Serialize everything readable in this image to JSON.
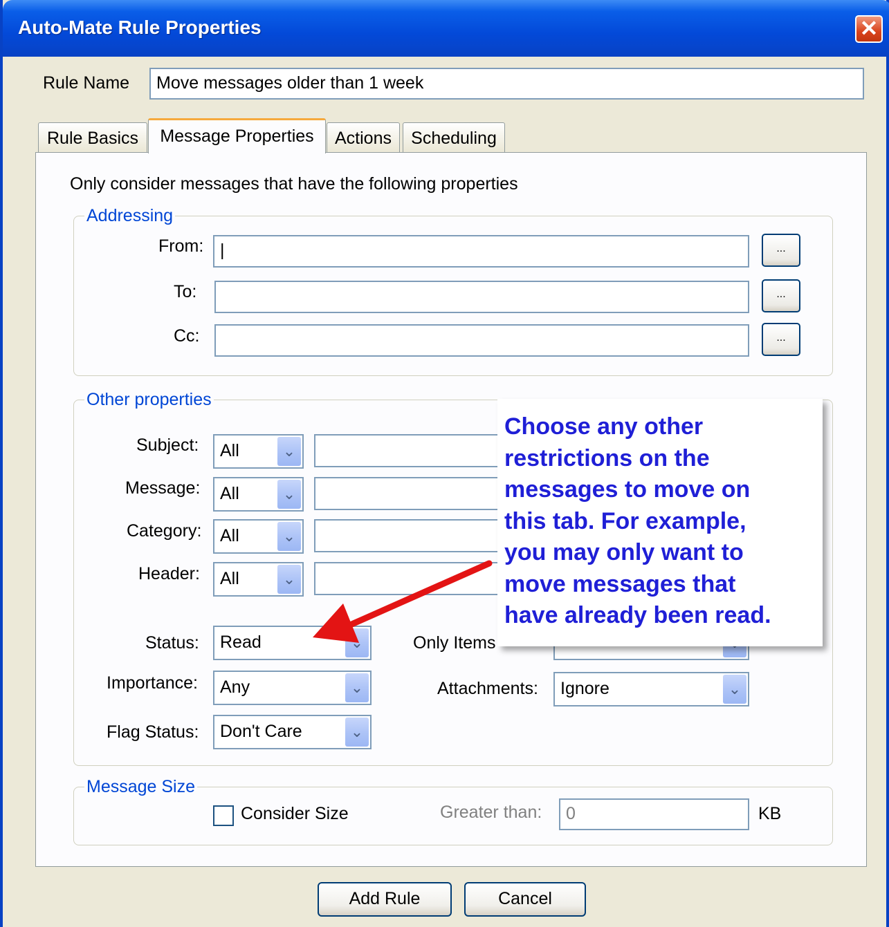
{
  "window": {
    "title": "Auto-Mate Rule Properties",
    "close_glyph": "✕"
  },
  "rule_name": {
    "label": "Rule Name",
    "value": "Move messages older than 1 week"
  },
  "tabs": [
    {
      "label": "Rule Basics",
      "active": false
    },
    {
      "label": "Message Properties",
      "active": true
    },
    {
      "label": "Actions",
      "active": false
    },
    {
      "label": "Scheduling",
      "active": false
    }
  ],
  "intro": "Only consider messages that have the following properties",
  "addressing": {
    "title": "Addressing",
    "from_label": "From:",
    "from_value": "|",
    "to_label": "To:",
    "to_value": "",
    "cc_label": "Cc:",
    "cc_value": "",
    "browse_label": "..."
  },
  "other_properties": {
    "title": "Other properties",
    "subject_label": "Subject:",
    "subject_combo": "All",
    "message_label": "Message:",
    "message_combo": "All",
    "category_label": "Category:",
    "category_combo": "All",
    "header_label": "Header:",
    "header_combo": "All",
    "status_label": "Status:",
    "status_value": "Read",
    "importance_label": "Importance:",
    "importance_value": "Any",
    "flag_label": "Flag Status:",
    "flag_value": "Don't Care",
    "only_items_label": "Only Items",
    "attachments_label": "Attachments:",
    "attachments_value": "Ignore"
  },
  "message_size": {
    "title": "Message Size",
    "consider_label": "Consider Size",
    "consider_checked": false,
    "greater_label": "Greater than:",
    "greater_value": "0",
    "unit": "KB"
  },
  "buttons": {
    "add": "Add Rule",
    "cancel": "Cancel"
  },
  "callout": {
    "text": "Choose any other\nrestrictions on the\nmessages to move on\nthis tab. For example,\nyou may only want to\nmove messages that\nhave already been read.",
    "color": "#1f1fd6",
    "arrow_color": "#e31414"
  },
  "dropdown_glyph": "⌄"
}
